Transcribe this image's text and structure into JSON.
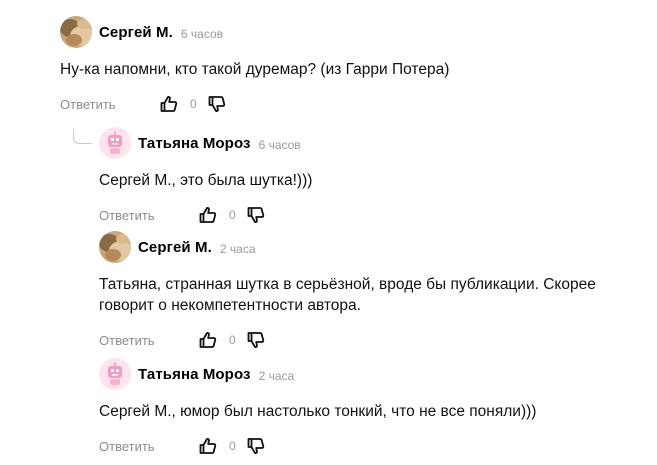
{
  "comments": [
    {
      "author": "Сергей М.",
      "time": "6 часов",
      "text": "Ну-ка напомни, кто такой дуремар? (из Гарри Потера)",
      "reply_label": "Ответить",
      "likes": "0",
      "avatar": "photo"
    },
    {
      "author": "Татьяна Мороз",
      "time": "6 часов",
      "text": "Сергей М., это была шутка!)))",
      "reply_label": "Ответить",
      "likes": "0",
      "avatar": "pink-robot"
    },
    {
      "author": "Сергей М.",
      "time": "2 часа",
      "text": "Татьяна, странная шутка в серьёзной, вроде бы публикации. Скорее говорит о некомпетентности автора.",
      "reply_label": "Ответить",
      "likes": "0",
      "avatar": "photo"
    },
    {
      "author": "Татьяна Мороз",
      "time": "2 часа",
      "text": "Сергей М., юмор был настолько тонкий, что не все поняли)))",
      "reply_label": "Ответить",
      "likes": "0",
      "avatar": "pink-robot"
    }
  ],
  "icons": {
    "like": "thumbs-up-icon",
    "dislike": "thumbs-down-icon"
  },
  "colors": {
    "meta_gray": "#9a9a9a",
    "pink_avatar": "#f6b8d1"
  }
}
